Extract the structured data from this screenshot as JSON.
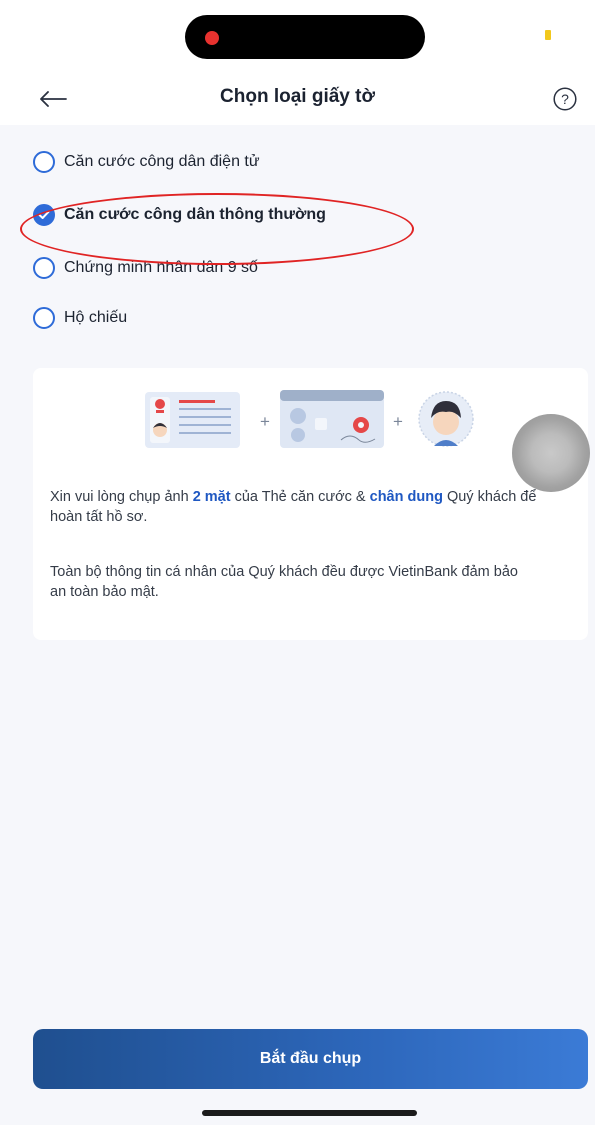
{
  "header": {
    "title": "Chọn loại giấy tờ",
    "back_icon": "arrow-left-icon",
    "help_icon": "question-circle-icon",
    "help_symbol": "?"
  },
  "document_types": [
    {
      "label": "Căn cước công dân điện tử",
      "selected": false
    },
    {
      "label": "Căn cước công dân thông thường",
      "selected": true
    },
    {
      "label": "Chứng minh nhân dân 9 số",
      "selected": false
    },
    {
      "label": "Hộ chiếu",
      "selected": false
    }
  ],
  "info": {
    "icons": [
      "id-card-front-icon",
      "id-card-back-icon",
      "portrait-face-icon"
    ],
    "plus_symbol": "+",
    "line1_part1": "Xin vui lòng chụp ảnh ",
    "line1_bold1": "2 mặt",
    "line1_part2": " của Thẻ căn cước & ",
    "line1_bold2": "chân dung",
    "line1_part3": " Quý khách để hoàn tất hồ sơ.",
    "line2": "Toàn bộ thông tin cá nhân của Quý khách đều được VietinBank đảm bảo an toàn bảo mật."
  },
  "footer": {
    "start_button_label": "Bắt đầu chụp"
  },
  "colors": {
    "accent": "#2e6bd8",
    "highlight_text": "#1f58c2",
    "annotation_red": "#e02424",
    "button_gradient_start": "#1f4f8f",
    "button_gradient_end": "#3b7bd6"
  }
}
